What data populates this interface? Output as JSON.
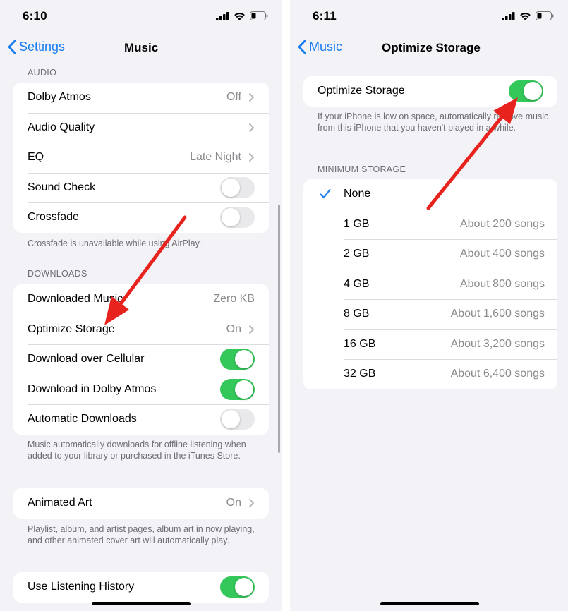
{
  "left": {
    "status": {
      "time": "6:10"
    },
    "nav": {
      "back_label": "Settings",
      "title": "Music"
    },
    "audio": {
      "header": "AUDIO",
      "rows": [
        {
          "label": "Dolby Atmos",
          "value": "Off"
        },
        {
          "label": "Audio Quality",
          "value": ""
        },
        {
          "label": "EQ",
          "value": "Late Night"
        },
        {
          "label": "Sound Check",
          "toggle": "off"
        },
        {
          "label": "Crossfade",
          "toggle": "off"
        }
      ],
      "footer": "Crossfade is unavailable while using AirPlay."
    },
    "downloads": {
      "header": "DOWNLOADS",
      "rows": [
        {
          "label": "Downloaded Music",
          "value": "Zero KB"
        },
        {
          "label": "Optimize Storage",
          "value": "On"
        },
        {
          "label": "Download over Cellular",
          "toggle": "on"
        },
        {
          "label": "Download in Dolby Atmos",
          "toggle": "on"
        },
        {
          "label": "Automatic Downloads",
          "toggle": "off"
        }
      ],
      "footer": "Music automatically downloads for offline listening when added to your library or purchased in the iTunes Store."
    },
    "animated": {
      "label": "Animated Art",
      "value": "On",
      "footer": "Playlist, album, and artist pages, album art in now playing, and other animated cover art will automatically play."
    },
    "history": {
      "label": "Use Listening History",
      "toggle": "on"
    }
  },
  "right": {
    "status": {
      "time": "6:11"
    },
    "nav": {
      "back_label": "Music",
      "title": "Optimize Storage"
    },
    "optimize": {
      "label": "Optimize Storage",
      "toggle": "on",
      "footer": "If your iPhone is low on space, automatically remove music from this iPhone that you haven't played in a while."
    },
    "minimum": {
      "header": "MINIMUM STORAGE",
      "rows": [
        {
          "label": "None",
          "value": "",
          "checked": true
        },
        {
          "label": "1 GB",
          "value": "About 200 songs"
        },
        {
          "label": "2 GB",
          "value": "About 400 songs"
        },
        {
          "label": "4 GB",
          "value": "About 800 songs"
        },
        {
          "label": "8 GB",
          "value": "About 1,600 songs"
        },
        {
          "label": "16 GB",
          "value": "About 3,200 songs"
        },
        {
          "label": "32 GB",
          "value": "About 6,400 songs"
        }
      ]
    }
  },
  "colors": {
    "accent": "#1a7ef0",
    "toggle_on": "#34c759",
    "annotation_arrow": "#e8231e"
  }
}
